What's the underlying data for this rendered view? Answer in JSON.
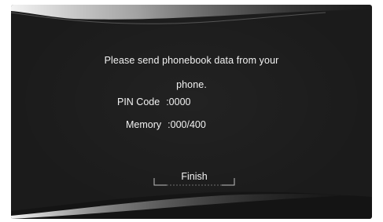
{
  "dialog": {
    "message_line1": "Please send phonebook data from your",
    "message_line2": "phone.",
    "pin_label": "PIN Code",
    "pin_value": ":0000",
    "memory_label": "Memory",
    "memory_value": ":000/400",
    "finish_label": "Finish"
  }
}
